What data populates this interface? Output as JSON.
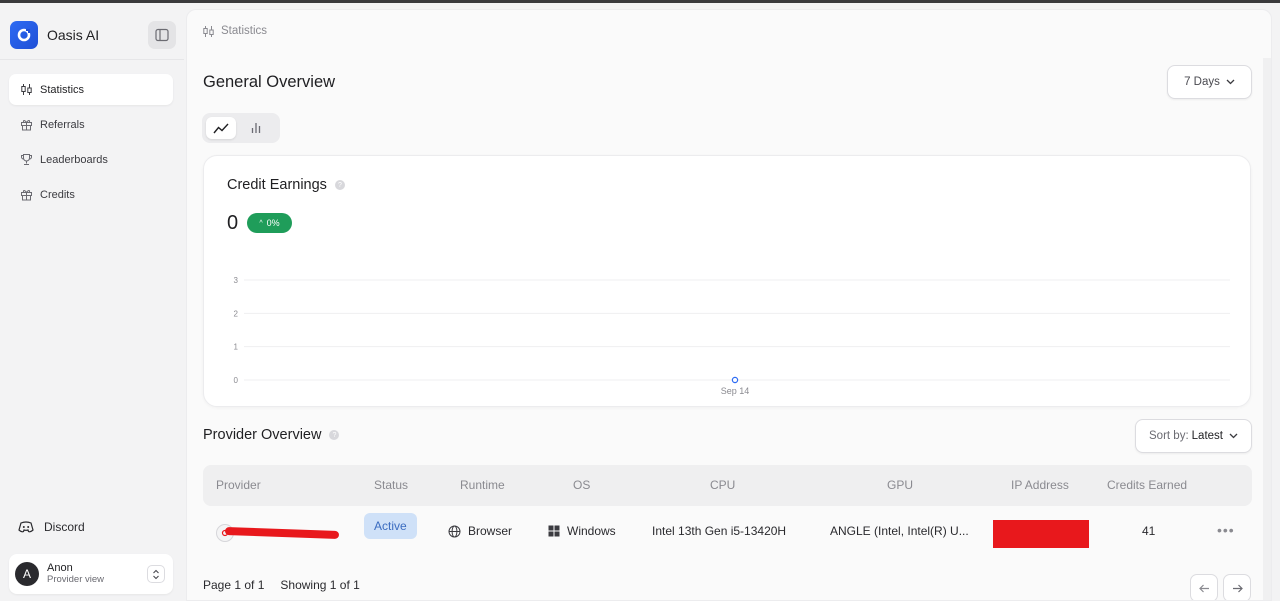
{
  "app": {
    "name": "Oasis AI"
  },
  "sidebar": {
    "items": [
      {
        "label": "Statistics",
        "icon": "candlestick-icon",
        "active": true
      },
      {
        "label": "Referrals",
        "icon": "gift-icon",
        "active": false
      },
      {
        "label": "Leaderboards",
        "icon": "trophy-icon",
        "active": false
      },
      {
        "label": "Credits",
        "icon": "gift-icon",
        "active": false
      }
    ],
    "discord_label": "Discord",
    "user": {
      "initial": "A",
      "name": "Anon",
      "role": "Provider view"
    }
  },
  "breadcrumb": {
    "label": "Statistics"
  },
  "overview": {
    "title": "General Overview",
    "range_select": "7 Days",
    "chart_modes": [
      "line-chart-icon",
      "bar-chart-icon"
    ]
  },
  "credit_card": {
    "title": "Credit Earnings",
    "value": "0",
    "change": "0%",
    "badge_color": "#1f9d5a"
  },
  "chart_data": {
    "type": "line",
    "x": [
      "Sep 14"
    ],
    "series": [
      {
        "values": [
          0
        ]
      }
    ],
    "yticks": [
      "3",
      "2",
      "1",
      "0"
    ],
    "ylim": [
      0,
      3
    ],
    "grid": true
  },
  "provider": {
    "title": "Provider Overview",
    "sort_label": "Sort by:",
    "sort_value": "Latest",
    "columns": [
      "Provider",
      "Status",
      "Runtime",
      "OS",
      "CPU",
      "GPU",
      "IP Address",
      "Credits Earned"
    ],
    "rows": [
      {
        "status": "Active",
        "runtime": "Browser",
        "os": "Windows",
        "cpu": "Intel 13th Gen i5-13420H",
        "gpu": "ANGLE (Intel, Intel(R) U...",
        "credits": "41",
        "menu": "•••"
      }
    ],
    "pagination": {
      "page": "Page 1 of 1",
      "showing": "Showing 1 of 1"
    }
  },
  "colors": {
    "accent": "#2d6bf3",
    "active_badge_bg": "#cfe1f8",
    "redaction": "#e8181c"
  }
}
